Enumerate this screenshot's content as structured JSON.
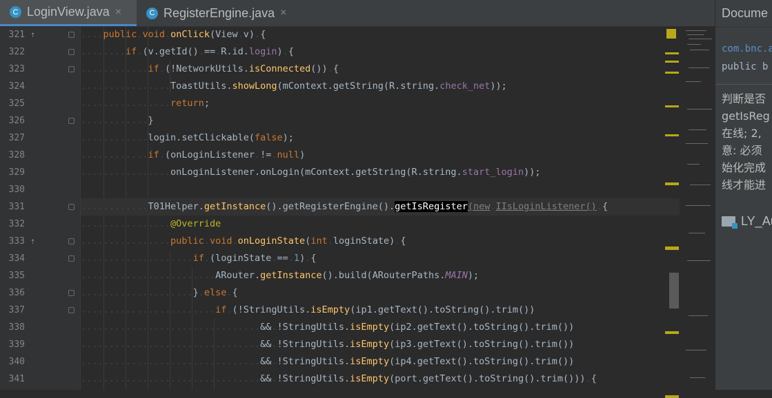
{
  "tabs": [
    {
      "label": "LoginView.java",
      "icon": "C",
      "active": true
    },
    {
      "label": "RegisterEngine.java",
      "icon": "C",
      "active": false
    }
  ],
  "close_glyph": "×",
  "line_numbers": [
    "321",
    "322",
    "323",
    "324",
    "325",
    "326",
    "327",
    "328",
    "329",
    "330",
    "331",
    "332",
    "333",
    "334",
    "335",
    "336",
    "337",
    "338",
    "339",
    "340",
    "341"
  ],
  "code": [
    {
      "indent": "....",
      "parts": [
        [
          "kw",
          "public"
        ],
        [
          "ws",
          "."
        ],
        [
          "kw",
          "void"
        ],
        [
          "ws",
          "."
        ],
        [
          "fn",
          "onClick"
        ],
        [
          "",
          "(View"
        ],
        [
          "ws",
          "."
        ],
        [
          "",
          "v)"
        ],
        [
          "ws",
          "."
        ],
        [
          "",
          "{"
        ]
      ]
    },
    {
      "indent": "........",
      "parts": [
        [
          "kw",
          "if"
        ],
        [
          "ws",
          "."
        ],
        [
          "",
          "(v.getId()"
        ],
        [
          "ws",
          "."
        ],
        [
          "",
          "=="
        ],
        [
          "ws",
          "."
        ],
        [
          "",
          "R.id."
        ],
        [
          "st",
          "login"
        ],
        [
          "",
          ")"
        ],
        [
          "ws",
          "."
        ],
        [
          "",
          "{"
        ]
      ]
    },
    {
      "indent": "............",
      "parts": [
        [
          "kw",
          "if"
        ],
        [
          "ws",
          "."
        ],
        [
          "",
          "(!NetworkUtils."
        ],
        [
          "fn",
          "isConnected"
        ],
        [
          "",
          "())"
        ],
        [
          "ws",
          "."
        ],
        [
          "",
          "{"
        ]
      ]
    },
    {
      "indent": "................",
      "parts": [
        [
          "",
          "ToastUtils."
        ],
        [
          "fn",
          "showLong"
        ],
        [
          "",
          "(mContext.getString(R.string."
        ],
        [
          "st",
          "check_net"
        ],
        [
          "",
          "));"
        ]
      ]
    },
    {
      "indent": "................",
      "parts": [
        [
          "kw",
          "return"
        ],
        [
          "",
          ";"
        ]
      ]
    },
    {
      "indent": "............",
      "parts": [
        [
          "",
          "}"
        ]
      ]
    },
    {
      "indent": "............",
      "parts": [
        [
          "",
          "login.setClickable("
        ],
        [
          "kw",
          "false"
        ],
        [
          "",
          ");"
        ]
      ]
    },
    {
      "indent": "............",
      "parts": [
        [
          "kw",
          "if"
        ],
        [
          "ws",
          "."
        ],
        [
          "",
          "(onLoginListener"
        ],
        [
          "ws",
          "."
        ],
        [
          "",
          "!="
        ],
        [
          "ws",
          "."
        ],
        [
          "kw",
          "null"
        ],
        [
          "",
          ")"
        ]
      ]
    },
    {
      "indent": "................",
      "parts": [
        [
          "",
          "onLoginListener.onLogin(mContext.getString(R.string."
        ],
        [
          "st",
          "start_login"
        ],
        [
          "",
          "));"
        ]
      ]
    },
    {
      "indent": "",
      "parts": []
    },
    {
      "indent": "............",
      "parts": [
        [
          "",
          "T01Helper."
        ],
        [
          "fn",
          "getInstance"
        ],
        [
          "",
          "().getRegisterEngine()."
        ],
        [
          "hl",
          "getIsRegister"
        ],
        [
          "gray uline",
          "(new"
        ],
        [
          "ws",
          "."
        ],
        [
          "gray uline",
          "IIsLoginListener()"
        ],
        [
          "ws",
          "."
        ],
        [
          "",
          "{"
        ]
      ]
    },
    {
      "indent": "................",
      "parts": [
        [
          "ann",
          "@Override"
        ]
      ]
    },
    {
      "indent": "................",
      "parts": [
        [
          "kw",
          "public"
        ],
        [
          "ws",
          "."
        ],
        [
          "kw",
          "void"
        ],
        [
          "ws",
          "."
        ],
        [
          "fn",
          "onLoginState"
        ],
        [
          "",
          "("
        ],
        [
          "kw",
          "int"
        ],
        [
          "ws",
          "."
        ],
        [
          "",
          "loginState)"
        ],
        [
          "ws",
          "."
        ],
        [
          "",
          "{"
        ]
      ]
    },
    {
      "indent": "....................",
      "parts": [
        [
          "kw",
          "if"
        ],
        [
          "ws",
          "."
        ],
        [
          "",
          "(loginState"
        ],
        [
          "ws",
          "."
        ],
        [
          "",
          "=="
        ],
        [
          "ws",
          "."
        ],
        [
          "num",
          "1"
        ],
        [
          "",
          ")"
        ],
        [
          "ws",
          "."
        ],
        [
          "",
          "{"
        ]
      ]
    },
    {
      "indent": "........................",
      "parts": [
        [
          "",
          "ARouter."
        ],
        [
          "fn",
          "getInstance"
        ],
        [
          "",
          "().build(ARouterPaths."
        ],
        [
          "stI",
          "MAIN"
        ],
        [
          "",
          ");"
        ]
      ]
    },
    {
      "indent": "....................",
      "parts": [
        [
          "",
          "}"
        ],
        [
          "ws",
          "."
        ],
        [
          "kw",
          "else"
        ],
        [
          "ws",
          "."
        ],
        [
          "",
          "{"
        ]
      ]
    },
    {
      "indent": "........................",
      "parts": [
        [
          "kw",
          "if"
        ],
        [
          "ws",
          "."
        ],
        [
          "",
          "(!StringUtils."
        ],
        [
          "fn",
          "isEmpty"
        ],
        [
          "",
          "(ip1.getText().toString().trim())"
        ]
      ]
    },
    {
      "indent": "................................",
      "parts": [
        [
          "",
          "&&"
        ],
        [
          "ws",
          "."
        ],
        [
          "",
          "!StringUtils."
        ],
        [
          "fn",
          "isEmpty"
        ],
        [
          "",
          "(ip2.getText().toString().trim())"
        ]
      ]
    },
    {
      "indent": "................................",
      "parts": [
        [
          "",
          "&&"
        ],
        [
          "ws",
          "."
        ],
        [
          "",
          "!StringUtils."
        ],
        [
          "fn",
          "isEmpty"
        ],
        [
          "",
          "(ip3.getText().toString().trim())"
        ]
      ]
    },
    {
      "indent": "................................",
      "parts": [
        [
          "",
          "&&"
        ],
        [
          "ws",
          "."
        ],
        [
          "",
          "!StringUtils."
        ],
        [
          "fn",
          "isEmpty"
        ],
        [
          "",
          "(ip4.getText().toString().trim())"
        ]
      ]
    },
    {
      "indent": "................................",
      "parts": [
        [
          "",
          "&&"
        ],
        [
          "ws",
          "."
        ],
        [
          "",
          "!StringUtils."
        ],
        [
          "fn",
          "isEmpty"
        ],
        [
          "",
          "(port.getText().toString().trim()))"
        ],
        [
          "ws",
          "."
        ],
        [
          "",
          "{"
        ]
      ]
    }
  ],
  "current_line_index": 10,
  "doc_panel": {
    "title": "Docume",
    "package": "com.bnc.a",
    "signature": "public  b",
    "desc": [
      "判断是否",
      "getIsReg",
      "在线; 2,",
      "意: 必须",
      "始化完成",
      "线才能进"
    ],
    "module": "LY_Au"
  }
}
